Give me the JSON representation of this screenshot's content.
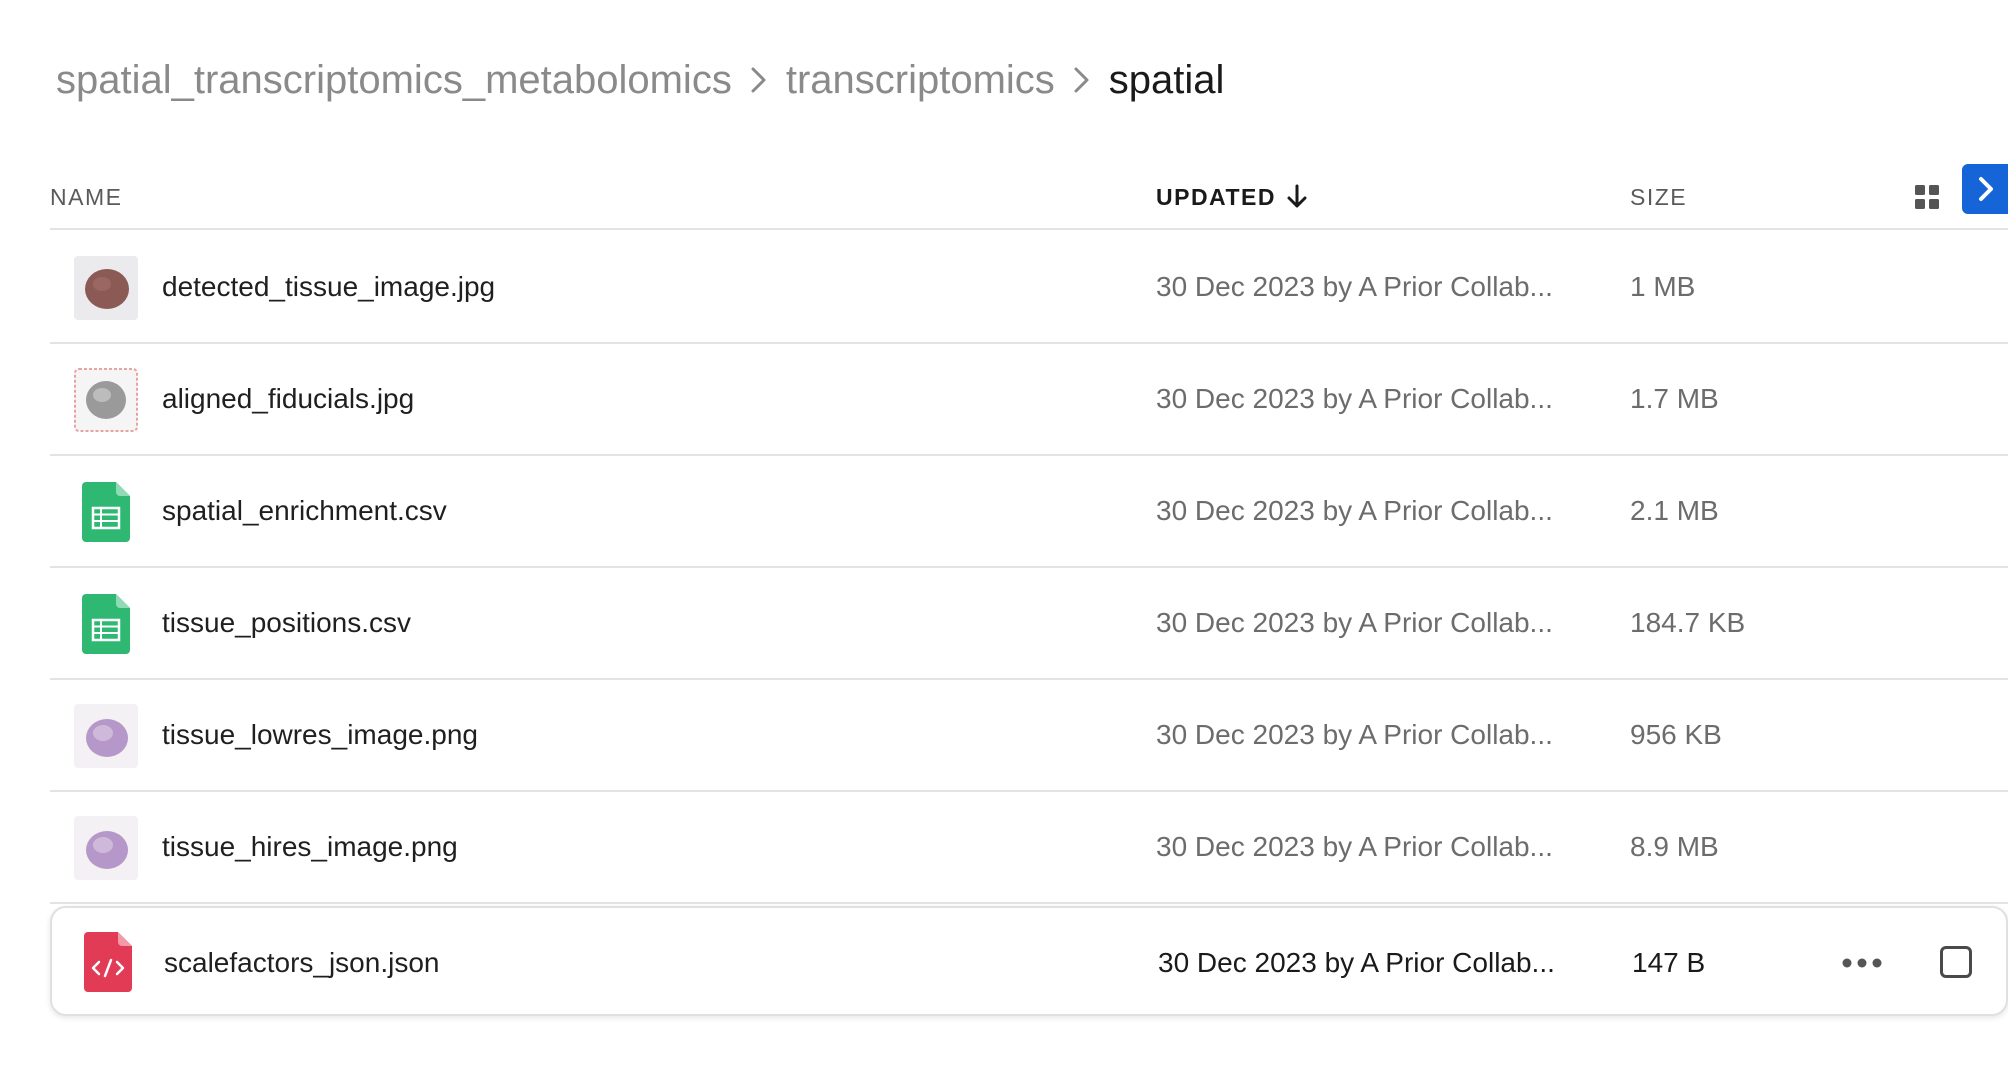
{
  "breadcrumb": {
    "items": [
      {
        "label": "spatial_transcriptomics_metabolomics"
      },
      {
        "label": "transcriptomics"
      },
      {
        "label": "spatial"
      }
    ]
  },
  "table": {
    "columns": {
      "name": "NAME",
      "updated": "UPDATED",
      "size": "SIZE"
    },
    "sort": {
      "column": "updated",
      "direction": "descending",
      "icon": "arrow-down-icon"
    },
    "rows": [
      {
        "name": "detected_tissue_image.jpg",
        "updated": "30 Dec 2023 by A Prior Collab...",
        "size": "1 MB",
        "icon": "tissue-thumbnail-brown",
        "color": "#8c5a55"
      },
      {
        "name": "aligned_fiducials.jpg",
        "updated": "30 Dec 2023 by A Prior Collab...",
        "size": "1.7 MB",
        "icon": "tissue-thumbnail-gray",
        "color": "#9a9a9a"
      },
      {
        "name": "spatial_enrichment.csv",
        "updated": "30 Dec 2023 by A Prior Collab...",
        "size": "2.1 MB",
        "icon": "spreadsheet-icon",
        "color": "#2eb872"
      },
      {
        "name": "tissue_positions.csv",
        "updated": "30 Dec 2023 by A Prior Collab...",
        "size": "184.7 KB",
        "icon": "spreadsheet-icon",
        "color": "#2eb872"
      },
      {
        "name": "tissue_lowres_image.png",
        "updated": "30 Dec 2023 by A Prior Collab...",
        "size": "956 KB",
        "icon": "tissue-thumbnail-purple",
        "color": "#b598c9"
      },
      {
        "name": "tissue_hires_image.png",
        "updated": "30 Dec 2023 by A Prior Collab...",
        "size": "8.9 MB",
        "icon": "tissue-thumbnail-purple",
        "color": "#b598c9"
      },
      {
        "name": "scalefactors_json.json",
        "updated": "30 Dec 2023 by A Prior Collab...",
        "size": "147 B",
        "icon": "code-file-icon",
        "color": "#e23b55",
        "selected": true
      }
    ]
  },
  "colors": {
    "accent": "#1565d8",
    "csv": "#2eb872",
    "json": "#e23b55",
    "divider": "#e3e3e3"
  }
}
